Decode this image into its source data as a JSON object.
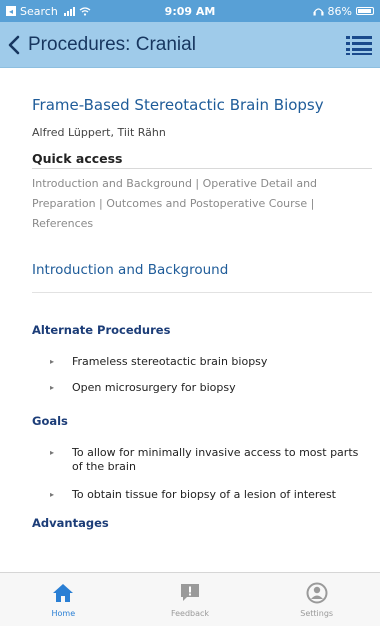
{
  "status_bar": {
    "carrier": "Search",
    "time": "9:09 AM",
    "battery": "86%"
  },
  "nav": {
    "title": "Procedures: Cranial"
  },
  "article": {
    "title": "Frame-Based Stereotactic Brain Biopsy",
    "authors": "Alfred Lüppert, Tiit Rähn",
    "quick_access_heading": "Quick access",
    "quick_access_links": "Introduction and Background | Operative Detail and Preparation | Outcomes and Postoperative Course | References",
    "section_link": "Introduction and Background"
  },
  "sections": {
    "alternate_heading": "Alternate Procedures",
    "alternate_items": [
      "Frameless stereotactic brain biopsy",
      "Open microsurgery for biopsy"
    ],
    "goals_heading": "Goals",
    "goals_items": [
      "To allow for minimally invasive access to most parts of the brain",
      "To obtain tissue for biopsy of a lesion of interest"
    ],
    "advantages_heading": "Advantages"
  },
  "tab_bar": {
    "tabs": [
      {
        "label": "Home",
        "icon": "home-icon"
      },
      {
        "label": "Feedback",
        "icon": "feedback-icon"
      },
      {
        "label": "Settings",
        "icon": "settings-icon"
      }
    ]
  },
  "colors": {
    "status_bar": "#58a0d6",
    "nav_bar": "#9fcbea",
    "link": "#1f5c99",
    "subhead": "#1c3d78",
    "accent": "#2a7fd4"
  }
}
